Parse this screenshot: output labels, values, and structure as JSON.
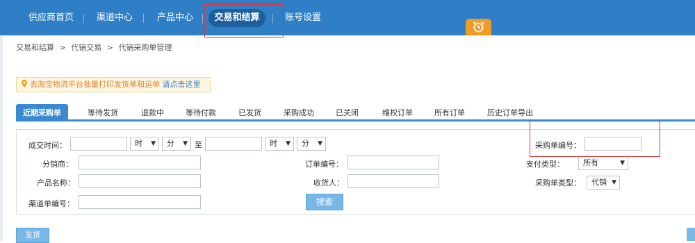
{
  "nav": {
    "items": [
      "供应商首页",
      "渠道中心",
      "产品中心",
      "交易和结算",
      "账号设置"
    ],
    "active": "交易和结算",
    "alarm_icon": "alarm-clock-icon"
  },
  "breadcrumb": [
    "交易和结算",
    ">",
    "代销交易",
    ">",
    "代销采购单管理"
  ],
  "notice": {
    "text": "去淘宝物流平台批量打印发货单和运单",
    "link": "请点击这里",
    "icon": "location-pin-icon"
  },
  "tabs": [
    "近期采购单",
    "等待发货",
    "退款中",
    "等待付款",
    "已发货",
    "采购成功",
    "已关闭",
    "维权订单",
    "所有订单",
    "历史订单导出"
  ],
  "search": {
    "deal_time_label": "成交时间：",
    "hour": "时",
    "minute": "分",
    "to": "至",
    "distributor_label": "分销商：",
    "product_name_label": "产品名称：",
    "channel_order_label": "渠道单编号：",
    "order_no_label": "订单编号：",
    "receiver_label": "收货人：",
    "pay_type_label": "支付类型：",
    "pay_type_value": "所有",
    "purchase_type_label": "采购单类型：",
    "purchase_type_value": "代销",
    "purchase_no_label": "采购单编号：",
    "search_button": "搜索"
  },
  "actions": {
    "ship_button": "发货"
  },
  "colors": {
    "nav_bg": "#2f7fc7",
    "accent": "#3a8ad2",
    "highlight": "#d9363e",
    "alarm": "#f39a24"
  }
}
